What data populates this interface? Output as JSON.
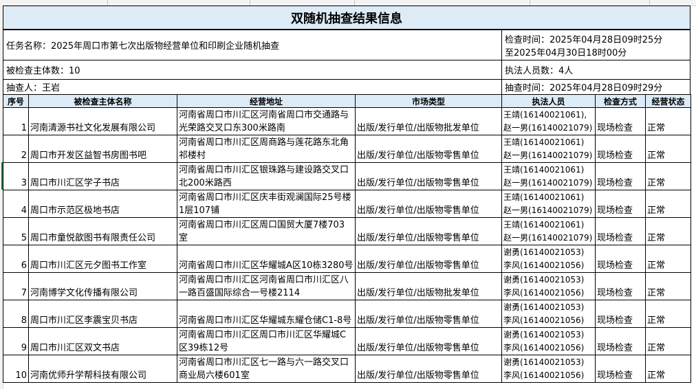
{
  "title": "双随机抽查结果信息",
  "task": {
    "name": "任务名称：2025年周口市第七次出版物经营单位和印刷企业随机抽查",
    "time_line1": "检查时间：2025年04月28日09时25分",
    "time_line2": "至2025年04月30日18时00分"
  },
  "counts": {
    "subjects": "被检查主体数：10",
    "officers": "执法人员数：4人"
  },
  "sampler": {
    "name": "抽查人：王岩",
    "time": "抽查时间：2025年04月28日09时29分"
  },
  "table": {
    "headers": [
      "序号",
      "被检查主体名称",
      "经营地址",
      "市场类型",
      "执法人员",
      "检查方式",
      "经营状态"
    ],
    "rows": [
      {
        "no": "1",
        "name": "河南清源书社文化发展有限公司",
        "address": "河南省周口市川汇区河南省周口市交通路与光荣路交叉口东300米路南",
        "market": "出版/发行单位/出版物批发单位",
        "officer1": "王靖(16140021061),",
        "officer2": "赵一男(16140021079)",
        "method": "现场检查",
        "status": "正常"
      },
      {
        "no": "2",
        "name": "周口市开发区益智书房图书吧",
        "address": "河南省周口市川汇区周商路与莲花路东北角祁楼村",
        "market": "出版/发行单位/出版物零售单位",
        "officer1": "王靖(16140021061)",
        "officer2": "赵一男(16140021079)",
        "method": "现场检查",
        "status": "正常"
      },
      {
        "no": "3",
        "name": "周口市川汇区学子书店",
        "address": "河南省周口市川汇区银珠路与建设路交叉口北200米路西",
        "market": "出版/发行单位/出版物零售单位",
        "officer1": "王靖(16140021061)",
        "officer2": "赵一男(16140021079)",
        "method": "现场检查",
        "status": "正常"
      },
      {
        "no": "4",
        "name": "周口市示范区极地书店",
        "address": "河南省周口市川汇区庆丰街观澜国际25号楼1层107铺",
        "market": "出版/发行单位/出版物零售单位",
        "officer1": "王靖(16140021061)",
        "officer2": "赵一男(16140021079)",
        "method": "现场检查",
        "status": "正常"
      },
      {
        "no": "5",
        "name": "周口市童悦歆图书有限责任公司",
        "address": "河南省周口市川汇区周口国贸大厦7楼703室",
        "market": "出版/发行单位/出版物零售单位",
        "officer1": "王靖(16140021061)",
        "officer2": "赵一男(16140021079)",
        "method": "现场检查",
        "status": "正常"
      },
      {
        "no": "6",
        "name": "周口市川汇区元夕图书工作室",
        "address": "河南省周口市川汇区华耀城A区10栋3280号",
        "market": "出版/发行单位/出版物零售单位",
        "officer1": "谢勇(16140021053)",
        "officer2": "李风(16140021056)",
        "method": "现场检查",
        "status": "正常"
      },
      {
        "no": "7",
        "name": "河南博学文化传播有限公司",
        "address": "河南省周口市川汇区河南省周口市川汇区八一路百盛国际综合一号楼2114",
        "market": "出版/发行单位/出版物批发单位",
        "officer1": "谢勇(16140021053)",
        "officer2": "李风(16140021056)",
        "method": "现场检查",
        "status": "正常"
      },
      {
        "no": "8",
        "name": "周口市川汇区李震宝贝书店",
        "address": "河南省周口市川汇区华耀城东耀仓储C1-8号",
        "market": "出版/发行单位/出版物零售单位",
        "officer1": "谢勇(16140021053)",
        "officer2": "李风(16140021056)",
        "method": "现场检查",
        "status": "正常"
      },
      {
        "no": "9",
        "name": "周口市川汇区双文书店",
        "address": "河南省周口市川汇区周口市川汇区华耀城C区39栋12号",
        "market": "出版/发行单位/出版物零售单位",
        "officer1": "谢勇(16140021053)",
        "officer2": "李风(16140021056)",
        "method": "现场检查",
        "status": "正常"
      },
      {
        "no": "10",
        "name": "河南优师升学帮科技有限公司",
        "address": "河南省周口市川汇区七一路与六一路交叉口商业局六楼601室",
        "market": "出版/发行单位/出版物零售单位",
        "officer1": "谢勇(16140021053)",
        "officer2": "李风(16140021056)",
        "method": "现场检查",
        "status": "正常"
      }
    ]
  }
}
